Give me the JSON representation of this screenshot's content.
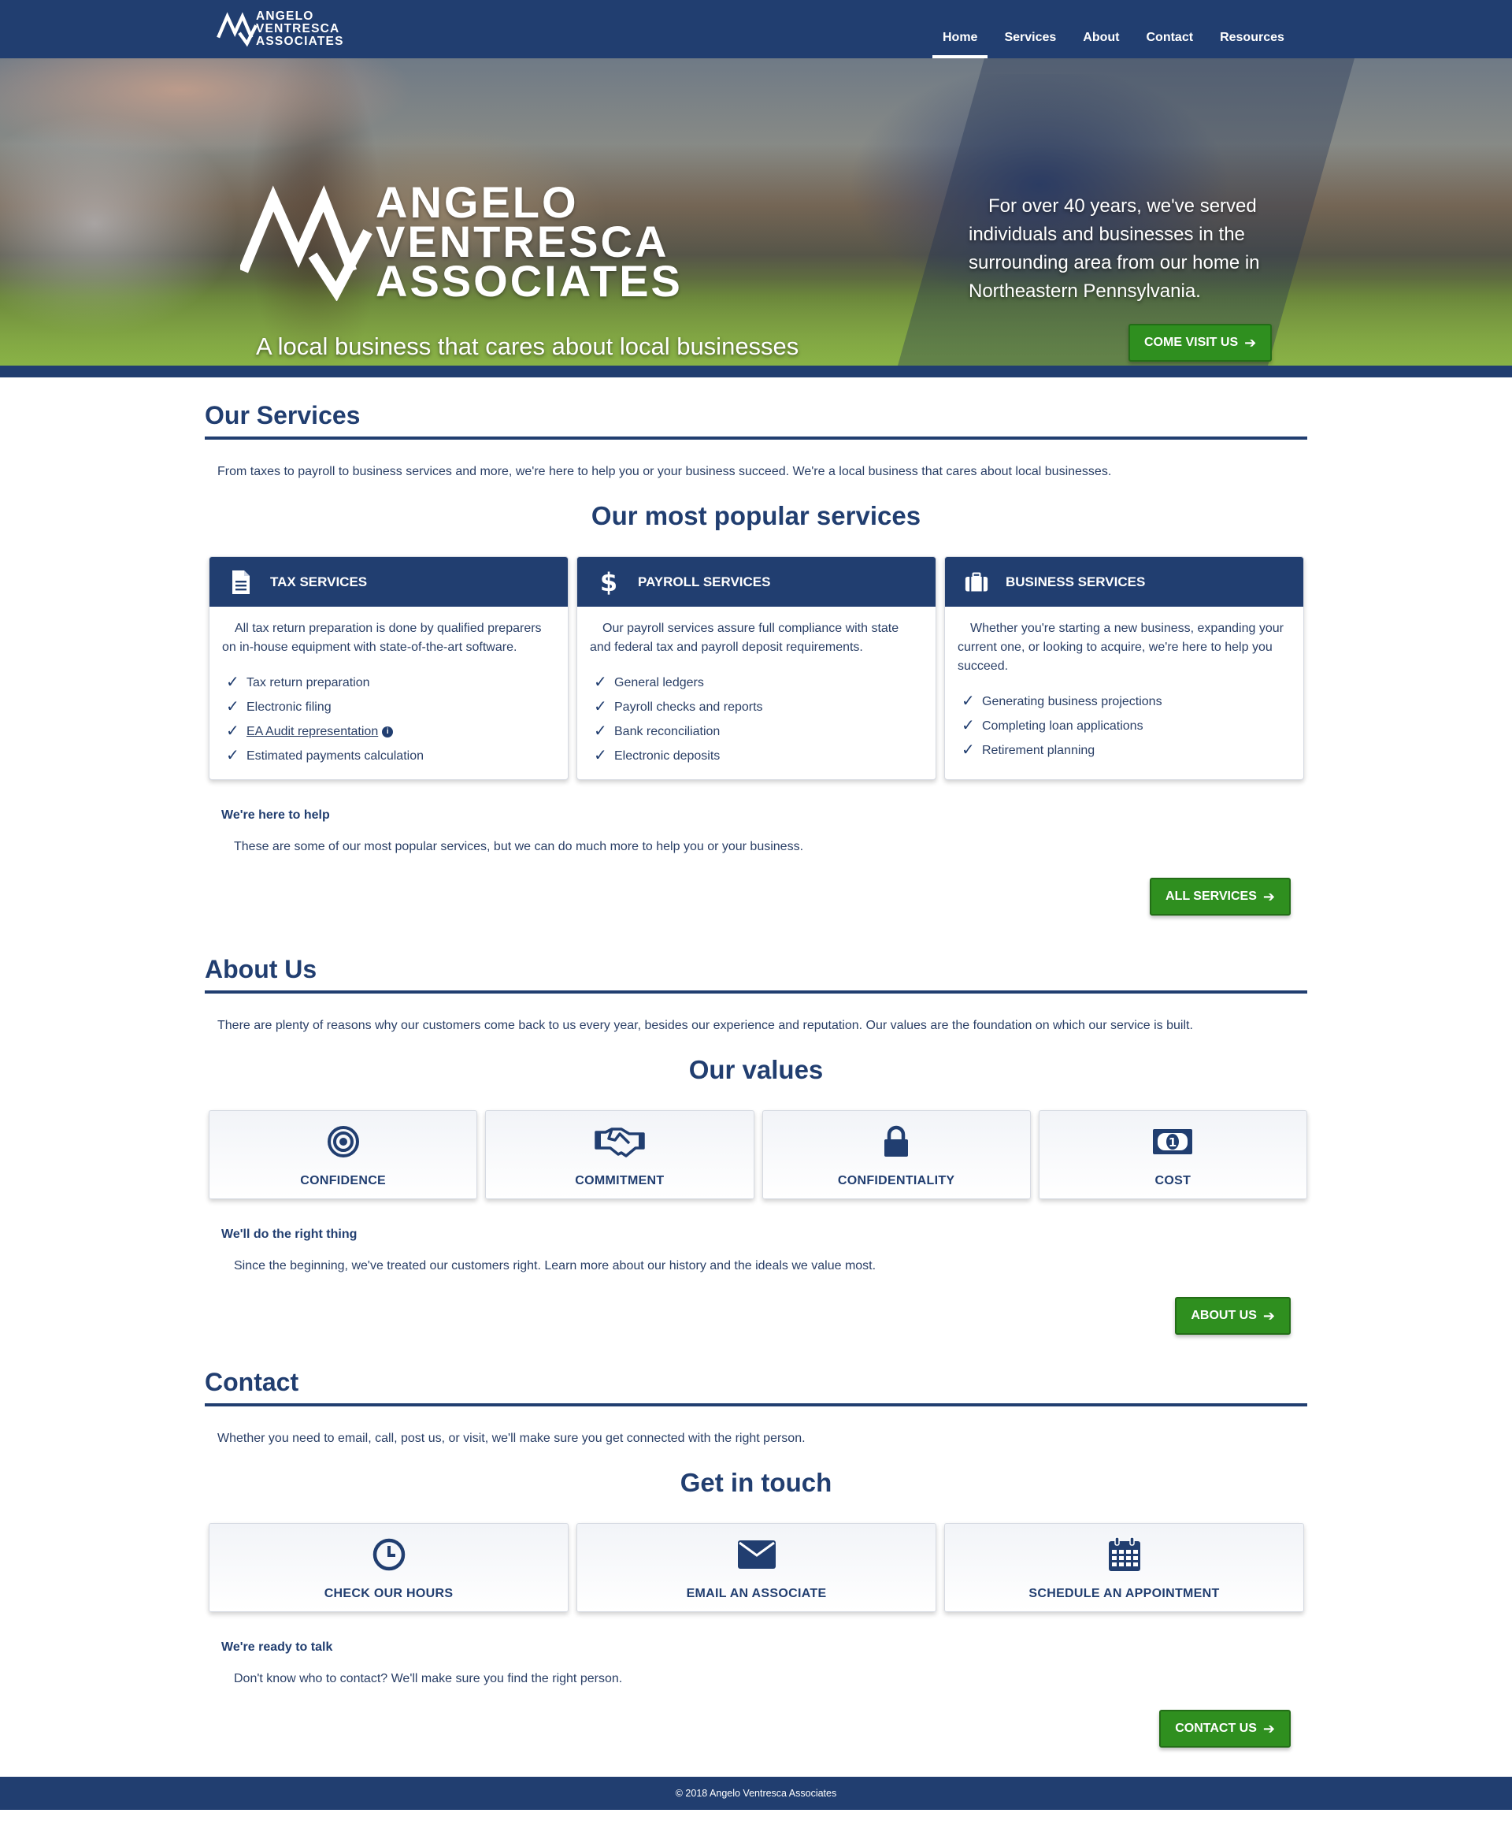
{
  "brand": {
    "line1": "ANGELO",
    "line2": "VENTRESCA",
    "line3": "ASSOCIATES"
  },
  "nav": {
    "items": [
      {
        "label": "Home",
        "active": true
      },
      {
        "label": "Services",
        "active": false
      },
      {
        "label": "About",
        "active": false
      },
      {
        "label": "Contact",
        "active": false
      },
      {
        "label": "Resources",
        "active": false
      }
    ]
  },
  "hero": {
    "tagline": "A local business that cares about local businesses",
    "blurb": "For over 40 years, we've served individuals and businesses in the surrounding area from our home in Northeastern Pennsylvania.",
    "cta": "COME VISIT US"
  },
  "services": {
    "title": "Our Services",
    "intro": "From taxes to payroll to business services and more, we're here to help you or your business succeed. We're a local business that cares about local businesses.",
    "subtitle": "Our most popular services",
    "cards": [
      {
        "title": "TAX SERVICES",
        "icon": "document-icon",
        "description": "All tax return preparation is done by qualified preparers on in-house equipment with state-of-the-art software.",
        "items": [
          "Tax return preparation",
          "Electronic filing",
          "EA Audit representation",
          "Estimated payments calculation"
        ]
      },
      {
        "title": "PAYROLL SERVICES",
        "icon": "dollar-icon",
        "description": "Our payroll services assure full compliance with state and federal tax and payroll deposit requirements.",
        "items": [
          "General ledgers",
          "Payroll checks and reports",
          "Bank reconciliation",
          "Electronic deposits"
        ]
      },
      {
        "title": "BUSINESS SERVICES",
        "icon": "briefcase-icon",
        "description": "Whether you're starting a new business, expanding your current one, or looking to acquire, we're here to help you succeed.",
        "items": [
          "Generating business projections",
          "Completing loan applications",
          "Retirement planning"
        ]
      }
    ],
    "help_title": "We're here to help",
    "help_text": "These are some of our most popular services, but we can do much more to help you or your business.",
    "cta": "ALL SERVICES"
  },
  "about": {
    "title": "About Us",
    "intro": "There are plenty of reasons why our customers come back to us every year, besides our experience and reputation. Our values are the foundation on which our service is built.",
    "subtitle": "Our values",
    "values": [
      {
        "label": "CONFIDENCE",
        "icon": "target-icon"
      },
      {
        "label": "COMMITMENT",
        "icon": "handshake-icon"
      },
      {
        "label": "CONFIDENTIALITY",
        "icon": "lock-icon"
      },
      {
        "label": "COST",
        "icon": "money-icon"
      }
    ],
    "help_title": "We'll do the right thing",
    "help_text": "Since the beginning, we've treated our customers right. Learn more about our history and the ideals we value most.",
    "cta": "ABOUT US"
  },
  "contact": {
    "title": "Contact",
    "intro": "Whether you need to email, call, post us, or visit, we'll make sure you get connected with the right person.",
    "subtitle": "Get in touch",
    "options": [
      {
        "label": "CHECK OUR HOURS",
        "icon": "clock-icon"
      },
      {
        "label": "EMAIL AN ASSOCIATE",
        "icon": "envelope-icon"
      },
      {
        "label": "SCHEDULE AN APPOINTMENT",
        "icon": "calendar-icon"
      }
    ],
    "help_title": "We're ready to talk",
    "help_text": "Don't know who to contact? We'll make sure you find the right person.",
    "cta": "CONTACT US"
  },
  "footer": {
    "copyright": "© 2018 Angelo Ventresca Associates"
  },
  "colors": {
    "navy": "#213e70",
    "green": "#2f8f1f",
    "white": "#ffffff"
  }
}
